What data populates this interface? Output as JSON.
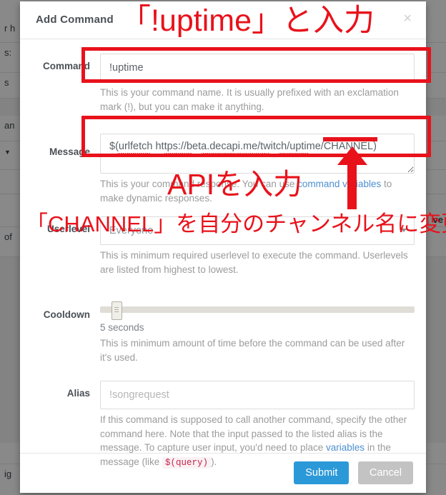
{
  "modal": {
    "title": "Add Command",
    "close_icon": "close-icon",
    "close_label": "×"
  },
  "form": {
    "command": {
      "label": "Command",
      "value": "!uptime",
      "placeholder": "!uptime",
      "help": "This is your command name. It is usually prefixed with an exclamation mark (!), but you can make it anything."
    },
    "message": {
      "label": "Message",
      "value": "$(urlfetch https://beta.decapi.me/twitch/uptime/CHANNEL)",
      "placeholder": "",
      "help_before": "This is your command response. You can use ",
      "help_link": "command variables",
      "help_after": " to make dynamic responses."
    },
    "userlevel": {
      "label": "Userlevel",
      "value": "Everyone",
      "options": [
        "Everyone"
      ],
      "help": "This is minimum required userlevel to execute the command. Userlevels are listed from highest to lowest.",
      "caret_icon": "chevron-down-icon"
    },
    "cooldown": {
      "label": "Cooldown",
      "value_text": "5 seconds",
      "help": "This is minimum amount of time before the command can be used after it's used.",
      "slider_percent": 4
    },
    "alias": {
      "label": "Alias",
      "value": "",
      "placeholder": "!songrequest",
      "help_1": "If this command is supposed to call another command, specify the other command here. Note that the input passed to the listed alias is the message. To capture user input, you'd need to place ",
      "help_link": "variables",
      "help_2": " in the message (like ",
      "help_code": "$(query)",
      "help_3": ")."
    }
  },
  "footer": {
    "submit_label": "Submit",
    "cancel_label": "Cancel"
  },
  "annotations": {
    "color": "#e8121b",
    "title_note": "「!uptime」と入力",
    "api_note": "APIを入力",
    "channel_note": "「CHANNEL」を自分のチャンネル名に変更",
    "arrow_icon": "up-arrow-icon",
    "command_box_icon": "highlight-box-icon",
    "message_box_icon": "highlight-box-icon",
    "channel_underline_icon": "underline-marker-icon"
  },
  "background": {
    "fragments": [
      "r h",
      "s:",
      "s",
      "an",
      "of",
      "ig"
    ],
    "right_fragment": "ve"
  }
}
